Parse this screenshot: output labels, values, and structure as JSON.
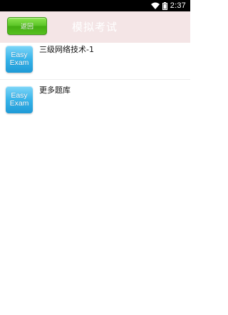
{
  "status_bar": {
    "time": "2:37",
    "icons": [
      "wifi-icon",
      "battery-icon"
    ]
  },
  "header": {
    "back_label": "返回",
    "title": "模拟考试",
    "background_color": "#f4e5e6",
    "back_button_color": "#5cc527"
  },
  "exam_list": {
    "items": [
      {
        "icon": "easy-exam-icon",
        "icon_text": [
          "Easy",
          "Exam"
        ],
        "label": "三级网络技术-1"
      },
      {
        "icon": "easy-exam-icon",
        "icon_text": [
          "Easy",
          "Exam"
        ],
        "label": "更多题库"
      }
    ]
  }
}
